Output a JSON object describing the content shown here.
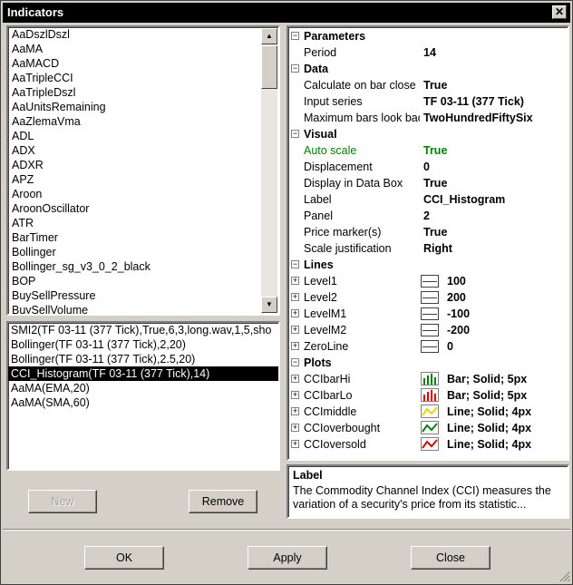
{
  "window": {
    "title": "Indicators"
  },
  "indicator_list": {
    "items": [
      "AaDszlDszl",
      "AaMA",
      "AaMACD",
      "AaTripleCCI",
      "AaTripleDszl",
      "AaUnitsRemaining",
      "AaZlemaVma",
      "ADL",
      "ADX",
      "ADXR",
      "APZ",
      "Aroon",
      "AroonOscillator",
      "ATR",
      "BarTimer",
      "Bollinger",
      "Bollinger_sg_v3_0_2_black",
      "BOP",
      "BuySellPressure",
      "BuySellVolume"
    ]
  },
  "applied_list": {
    "items": [
      "SMI2(TF 03-11 (377 Tick),True,6,3,long.wav,1,5,sho",
      "Bollinger(TF 03-11 (377 Tick),2,20)",
      "Bollinger(TF 03-11 (377 Tick),2.5,20)",
      "CCI_Histogram(TF 03-11 (377 Tick),14)",
      "AaMA(EMA,20)",
      "AaMA(SMA,60)"
    ],
    "selected_index": 3
  },
  "buttons": {
    "new": "New",
    "remove": "Remove",
    "ok": "OK",
    "apply": "Apply",
    "close": "Close"
  },
  "properties": {
    "parameters": {
      "label": "Parameters",
      "period_name": "Period",
      "period_value": "14"
    },
    "data": {
      "label": "Data",
      "rows": [
        {
          "name": "Calculate on bar close",
          "value": "True"
        },
        {
          "name": "Input series",
          "value": "TF 03-11 (377 Tick)"
        },
        {
          "name": "Maximum bars look back",
          "value": "TwoHundredFiftySix"
        }
      ]
    },
    "visual": {
      "label": "Visual",
      "rows": [
        {
          "name": "Auto scale",
          "value": "True",
          "highlight": "#008000"
        },
        {
          "name": "Displacement",
          "value": "0"
        },
        {
          "name": "Display in Data Box",
          "value": "True"
        },
        {
          "name": "Label",
          "value": "CCI_Histogram"
        },
        {
          "name": "Panel",
          "value": "2"
        },
        {
          "name": "Price marker(s)",
          "value": "True"
        },
        {
          "name": "Scale justification",
          "value": "Right"
        }
      ]
    },
    "lines": {
      "label": "Lines",
      "rows": [
        {
          "name": "Level1",
          "value": "100"
        },
        {
          "name": "Level2",
          "value": "200"
        },
        {
          "name": "LevelM1",
          "value": "-100"
        },
        {
          "name": "LevelM2",
          "value": "-200"
        },
        {
          "name": "ZeroLine",
          "value": "0"
        }
      ]
    },
    "plots": {
      "label": "Plots",
      "rows": [
        {
          "name": "CCIbarHi",
          "value": "Bar; Solid; 5px",
          "icon": "green-bar-chart-icon",
          "color": "#008000"
        },
        {
          "name": "CCIbarLo",
          "value": "Bar; Solid; 5px",
          "icon": "red-bar-chart-icon",
          "color": "#e00000"
        },
        {
          "name": "CCImiddle",
          "value": "Line; Solid; 4px",
          "icon": "yellow-line-icon",
          "color": "#e8d800"
        },
        {
          "name": "CCIoverbought",
          "value": "Line; Solid; 4px",
          "icon": "green-line-icon",
          "color": "#008000"
        },
        {
          "name": "CCIoversold",
          "value": "Line; Solid; 4px",
          "icon": "red-line-icon",
          "color": "#e00000"
        }
      ]
    }
  },
  "description": {
    "title": "Label",
    "text": "The Commodity Channel Index (CCI) measures the variation of a security's price from its statistic..."
  },
  "icons": {
    "close": "close-icon",
    "scroll_up": "scroll-up-arrow-icon",
    "scroll_down": "scroll-down-arrow-icon",
    "expand": "collapse-minus-icon",
    "expand_plus": "expand-plus-icon"
  }
}
